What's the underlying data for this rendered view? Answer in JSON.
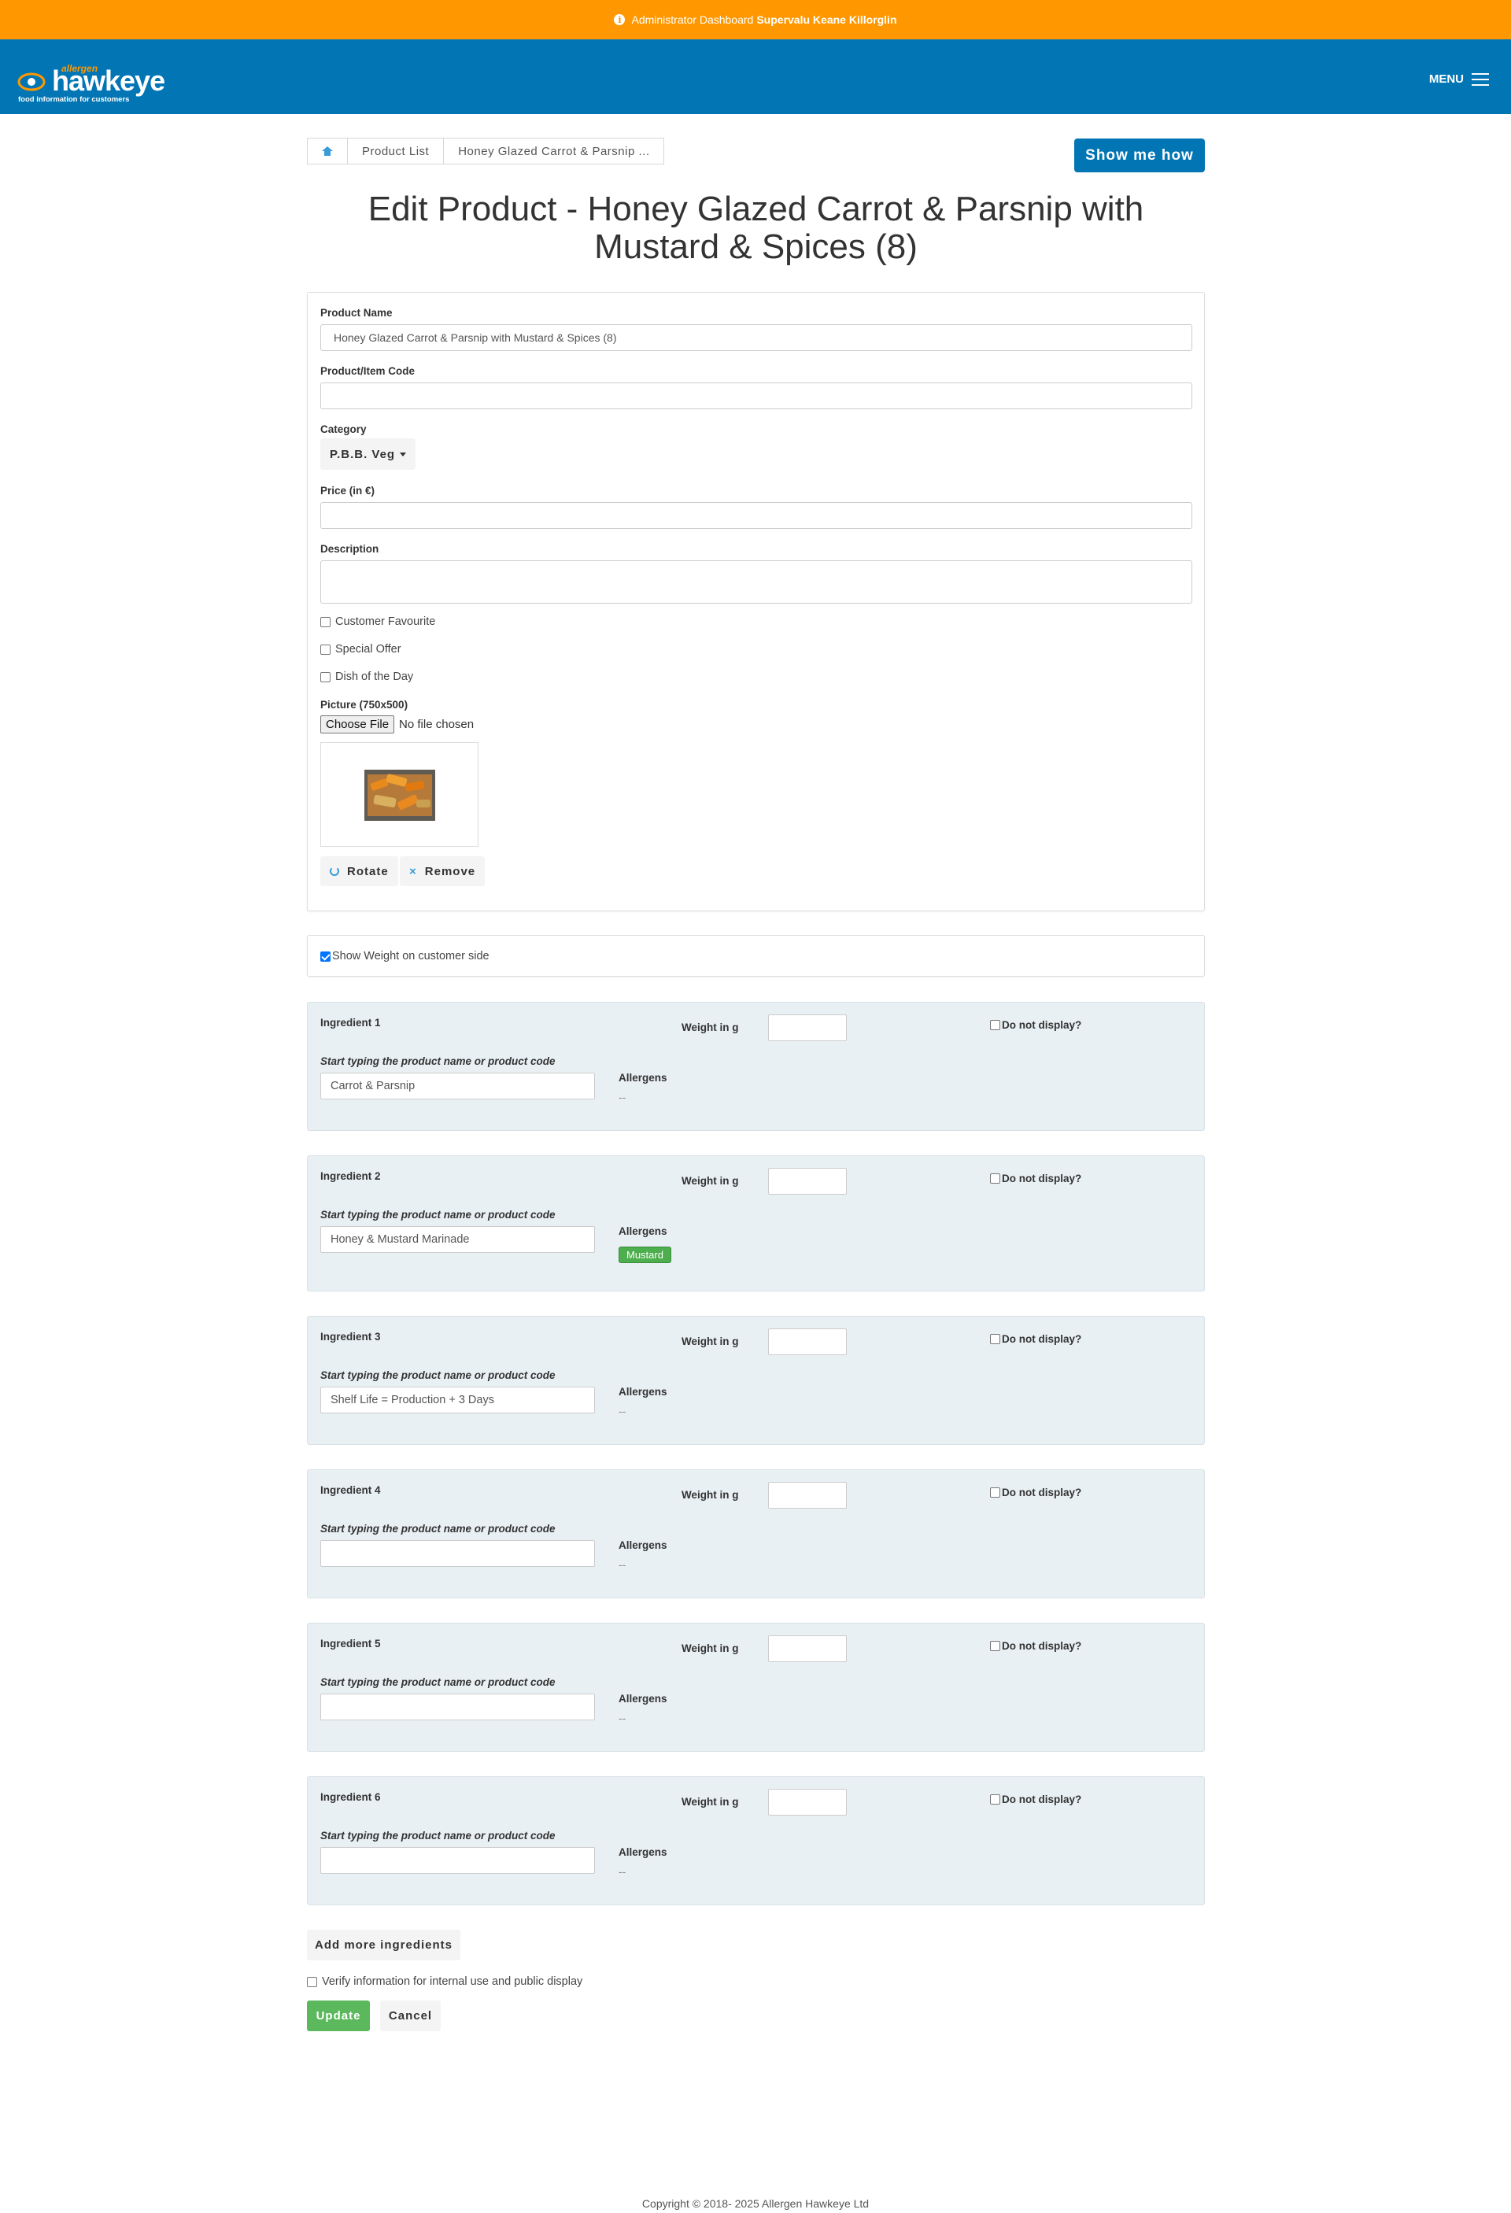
{
  "topbar": {
    "prefix": "Administrator Dashboard",
    "store": "Supervalu Keane Killorglin"
  },
  "brand": {
    "small": "allergen",
    "name": "hawkeye",
    "tagline": "food information for customers"
  },
  "nav": {
    "menu_label": "MENU"
  },
  "breadcrumb": {
    "items": [
      "Product List",
      "Honey Glazed Carrot & Parsnip ..."
    ]
  },
  "help_button": "Show me how",
  "page_title": "Edit Product - Honey Glazed Carrot & Parsnip with Mustard & Spices (8)",
  "form": {
    "product_name_label": "Product Name",
    "product_name_value": "Honey Glazed Carrot & Parsnip with Mustard & Spices (8)",
    "item_code_label": "Product/Item Code",
    "item_code_value": "",
    "category_label": "Category",
    "category_value": "P.B.B. Veg",
    "price_label": "Price (in €)",
    "price_value": "",
    "description_label": "Description",
    "description_value": "",
    "flags": [
      {
        "label": "Customer Favourite",
        "checked": false
      },
      {
        "label": "Special Offer",
        "checked": false
      },
      {
        "label": "Dish of the Day",
        "checked": false
      }
    ],
    "picture_label": "Picture (750x500)",
    "file_button": "Choose File",
    "file_status": "No file chosen",
    "rotate_label": "Rotate",
    "remove_label": "Remove"
  },
  "weight_panel": {
    "show_weight_label": "Show Weight on customer side",
    "checked": true
  },
  "ingredient_labels": {
    "weight": "Weight in g",
    "do_not_display": "Do not display?",
    "hint": "Start typing the product name or product code",
    "allergens": "Allergens"
  },
  "ingredients": [
    {
      "title": "Ingredient 1",
      "value": "Carrot & Parsnip",
      "allergens": "--"
    },
    {
      "title": "Ingredient 2",
      "value": "Honey & Mustard Marinade",
      "allergen_badge": "Mustard"
    },
    {
      "title": "Ingredient 3",
      "value": "Shelf Life = Production + 3 Days",
      "allergens": "--"
    },
    {
      "title": "Ingredient 4",
      "value": "",
      "allergens": "--"
    },
    {
      "title": "Ingredient 5",
      "value": "",
      "allergens": "--"
    },
    {
      "title": "Ingredient 6",
      "value": "",
      "allergens": "--"
    }
  ],
  "actions": {
    "add_more": "Add more ingredients",
    "verify_label": "Verify information for internal use and public display",
    "update": "Update",
    "cancel": "Cancel"
  },
  "footer": "Copyright © 2018- 2025 Allergen Hawkeye Ltd",
  "colors": {
    "topbar": "#ff9800",
    "navbar": "#0276b5",
    "allergen_badge": "#4cae4c",
    "update_button": "#5cb85c"
  }
}
